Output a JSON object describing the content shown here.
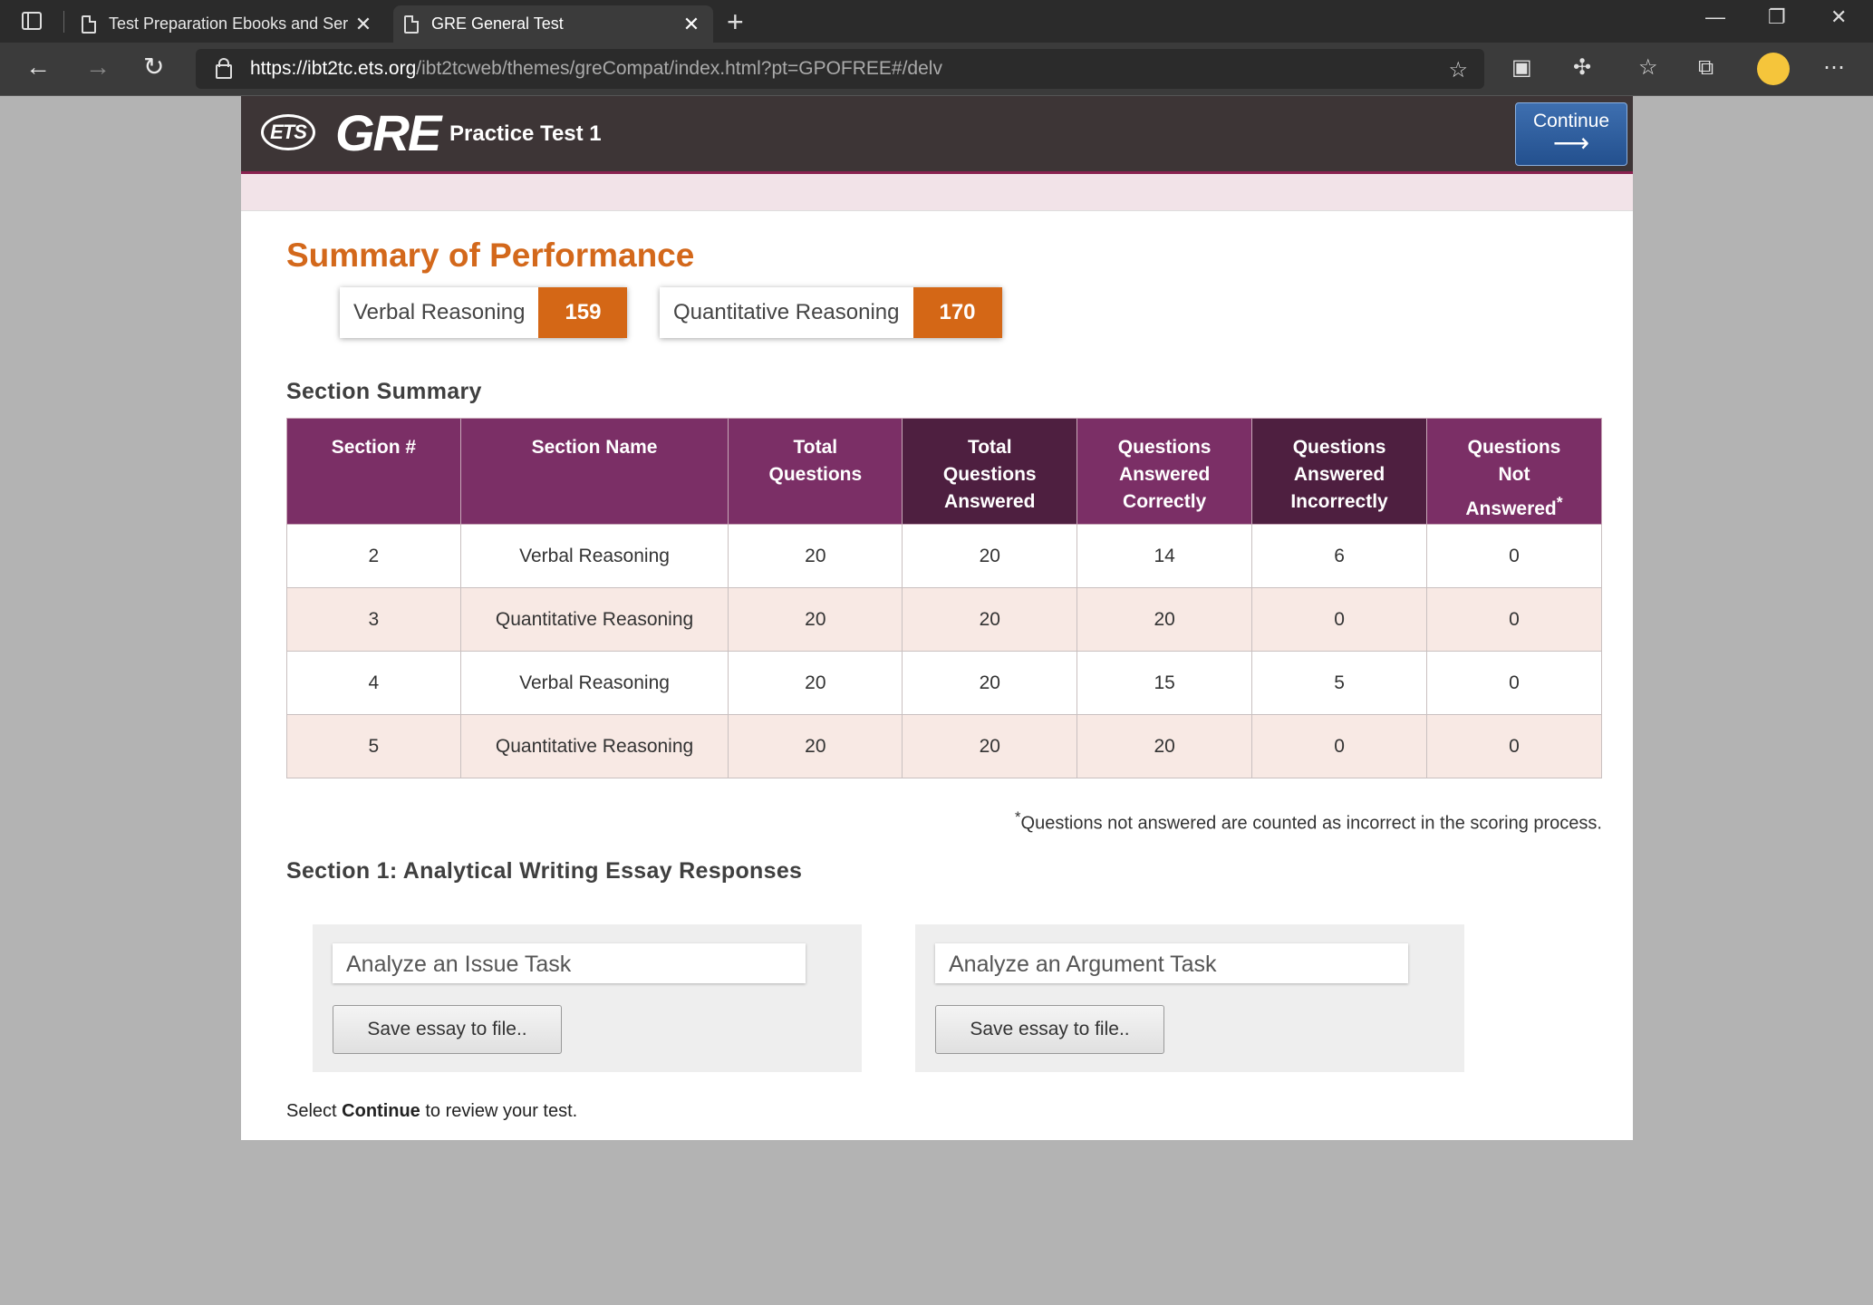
{
  "browser": {
    "tabs": [
      {
        "title": "Test Preparation Ebooks and Ser",
        "active": false
      },
      {
        "title": "GRE General Test",
        "active": true
      }
    ],
    "url_host": "https://ibt2tc.ets.org",
    "url_path": "/ibt2tcweb/themes/greCompat/index.html?pt=GPOFREE#/delv"
  },
  "header": {
    "ets_logo": "ETS",
    "gre_logo": "GRE",
    "test_title": "Practice Test 1",
    "continue_label": "Continue",
    "continue_arrow": "⟶"
  },
  "performance": {
    "title": "Summary of Performance",
    "scores": [
      {
        "label": "Verbal Reasoning",
        "value": "159"
      },
      {
        "label": "Quantitative Reasoning",
        "value": "170"
      }
    ]
  },
  "section_summary": {
    "title": "Section Summary",
    "headers": [
      "Section #",
      "Section Name",
      "Total Questions",
      "Total Questions Answered",
      "Questions Answered Correctly",
      "Questions Answered Incorrectly",
      "Questions Not Answered"
    ],
    "rows": [
      [
        "2",
        "Verbal Reasoning",
        "20",
        "20",
        "14",
        "6",
        "0"
      ],
      [
        "3",
        "Quantitative Reasoning",
        "20",
        "20",
        "20",
        "0",
        "0"
      ],
      [
        "4",
        "Verbal Reasoning",
        "20",
        "20",
        "15",
        "5",
        "0"
      ],
      [
        "5",
        "Quantitative Reasoning",
        "20",
        "20",
        "20",
        "0",
        "0"
      ]
    ],
    "footnote_marker": "*",
    "footnote": "Questions not answered are counted as incorrect in the scoring process."
  },
  "essays": {
    "title": "Section 1: Analytical Writing Essay Responses",
    "tasks": [
      {
        "name": "Analyze an Issue Task",
        "button": "Save essay to file.."
      },
      {
        "name": "Analyze an Argument Task",
        "button": "Save essay to file.."
      }
    ]
  },
  "instruction": {
    "prefix": "Select ",
    "bold": "Continue",
    "suffix": " to review your test."
  },
  "colors": {
    "accent_orange": "#d46716",
    "header_purple": "#7b2f66",
    "header_dark_purple": "#4e1f40",
    "continue_blue": "#2f5f9f"
  }
}
